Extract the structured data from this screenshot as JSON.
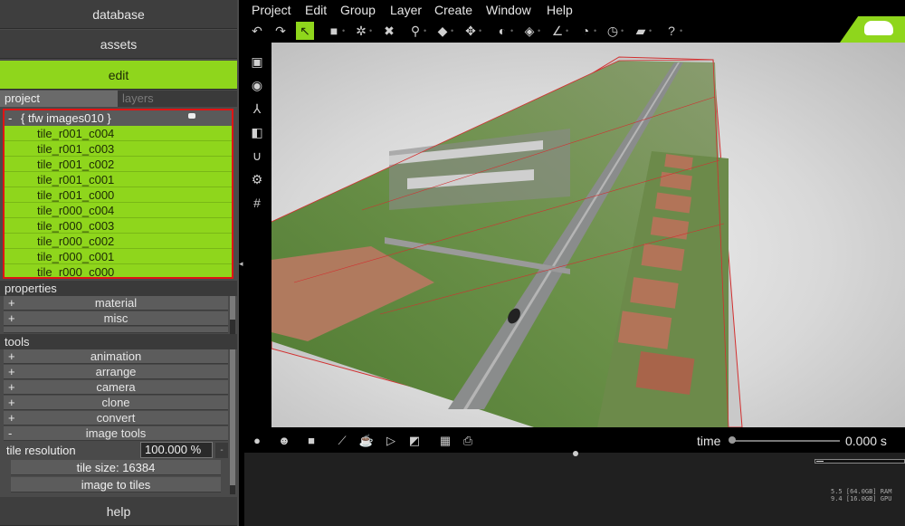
{
  "left_panel": {
    "buttons": {
      "database": "database",
      "assets": "assets",
      "edit": "edit",
      "help": "help"
    },
    "tabs": {
      "project": "project",
      "layers": "layers"
    },
    "tree": {
      "collapse_sign": "-",
      "root_label": "{ tfw images010 }",
      "items": [
        "tile_r001_c004",
        "tile_r001_c003",
        "tile_r001_c002",
        "tile_r001_c001",
        "tile_r001_c000",
        "tile_r000_c004",
        "tile_r000_c003",
        "tile_r000_c002",
        "tile_r000_c001",
        "tile_r000_c000"
      ]
    },
    "properties": {
      "label": "properties",
      "items": [
        {
          "sign": "+",
          "label": "material"
        },
        {
          "sign": "+",
          "label": "misc"
        }
      ]
    },
    "tools": {
      "label": "tools",
      "items": [
        {
          "sign": "+",
          "label": "animation"
        },
        {
          "sign": "+",
          "label": "arrange"
        },
        {
          "sign": "+",
          "label": "camera"
        },
        {
          "sign": "+",
          "label": "clone"
        },
        {
          "sign": "+",
          "label": "convert"
        },
        {
          "sign": "-",
          "label": "image tools"
        }
      ],
      "tile_resolution_label": "tile resolution",
      "tile_resolution_value": "100.000 %",
      "tile_size_button": "tile size: 16384",
      "image_to_tiles_button": "image to tiles"
    }
  },
  "menubar": [
    "Project",
    "Edit",
    "Group",
    "Layer",
    "Create",
    "Window",
    "Help"
  ],
  "toolbar_icons": [
    "undo-icon",
    "redo-icon",
    "select-arrow-icon",
    "selection-box-icon",
    "gizmo-icon",
    "delete-x-icon",
    "zoom-icon",
    "cube-icon",
    "move-icon",
    "measure-dial-icon",
    "plane-icon",
    "angle-icon",
    "gauge-icon",
    "clock-dial-icon",
    "ruler-icon",
    "help-circle-icon"
  ],
  "time": {
    "label": "time",
    "value": "0.000 s",
    "position": 0
  },
  "stats": {
    "ram": "5.5 [64.0GB] RAM",
    "gpu": "9.4 [16.0GB] GPU"
  },
  "colors": {
    "accent": "#8fd61c",
    "selection_border": "#e01414"
  }
}
